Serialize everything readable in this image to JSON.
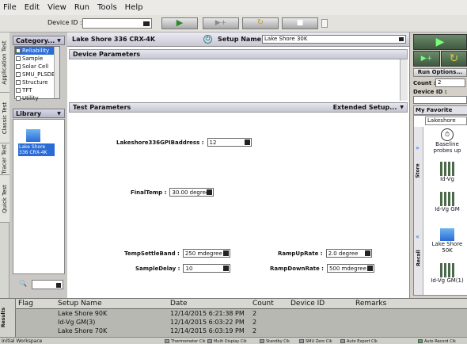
{
  "menu": [
    "File",
    "Edit",
    "View",
    "Run",
    "Tools",
    "Help"
  ],
  "toolbar": {
    "device_id_label": "Device ID :",
    "device_id_value": ""
  },
  "vertical_tabs": [
    "Application Test",
    "Classic Test",
    "Tracer Test",
    "Quick Test"
  ],
  "category": {
    "header": "Category...",
    "items": [
      "Reliability",
      "Sample",
      "Solar Cell",
      "SMU_PLSDE",
      "Structure",
      "TFT",
      "Utility"
    ]
  },
  "library": {
    "header": "Library",
    "item_label": "Lake Shore 336 CRX-4K",
    "search_value": ""
  },
  "main": {
    "instrument": "Lake Shore 336 CRX-4K",
    "setup_name_label": "Setup Name :",
    "setup_name_value": "Lake Shore 30K",
    "device_params_title": "Device Parameters",
    "test_params_title": "Test Parameters",
    "extended_setup": "Extended Setup...",
    "fields": [
      {
        "label": "Lakeshore336GPIBaddress :",
        "value": "12"
      },
      {
        "label": "FinalTemp :",
        "value": "30.00 degree"
      },
      {
        "label": "TempSettleBand :",
        "value": "250 mdegree"
      },
      {
        "label": "SampleDelay :",
        "value": "10"
      },
      {
        "label": "RampUpRate :",
        "value": "2.0 degree"
      },
      {
        "label": "RampDownRate :",
        "value": "500 mdegree"
      }
    ]
  },
  "right": {
    "run_options": "Run Options...",
    "count_label": "Count :",
    "count_value": "2",
    "device_id_label": "Device ID :",
    "my_favorite": "My Favorite",
    "fav_search": "Lakeshore",
    "store_label": "Store",
    "recall_label": "Recall",
    "favorites": [
      "Baseline probes up",
      "Id-Vg",
      "Id-Vg GM",
      "Lake Shore 50K",
      "Id-Vg GM(1)"
    ]
  },
  "results": {
    "side_label": "Results",
    "columns": [
      "Flag",
      "Setup Name",
      "Date",
      "Count",
      "Device ID",
      "Remarks"
    ],
    "rows": [
      {
        "setup": "Lake Shore 90K",
        "date": "12/14/2015 6:21:38 PM",
        "count": "2"
      },
      {
        "setup": "Id-Vg GM(3)",
        "date": "12/14/2015 6:03:22 PM",
        "count": "2"
      },
      {
        "setup": "Lake Shore 70K",
        "date": "12/14/2015 6:03:19 PM",
        "count": "2"
      }
    ]
  },
  "status": {
    "left": "Initial Workspace",
    "items": [
      "Thermometer Clk",
      "Multi Display Clk",
      "Standby Clk",
      "SMU Zero Clk",
      "Auto Export Clk",
      "Auto Record Clk"
    ]
  },
  "colors": {
    "run_green": "#4f6f4f",
    "accent": "#2a6bd6",
    "header": "#c8c7d6"
  }
}
